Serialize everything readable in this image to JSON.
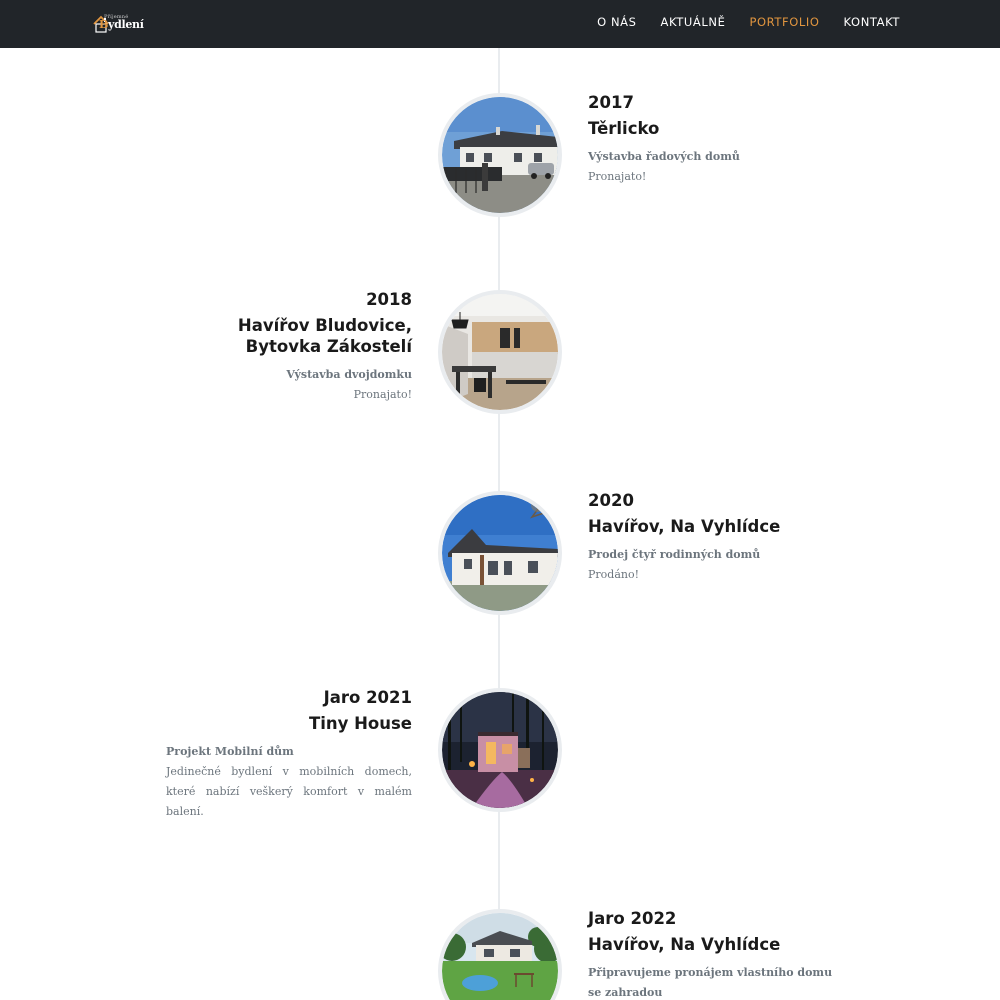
{
  "brand": {
    "small": "Příjemné",
    "name_first": "B",
    "name_rest": "ydlení"
  },
  "nav": [
    {
      "label": "O NÁS"
    },
    {
      "label": "AKTUÁLNĚ"
    },
    {
      "label": "PORTFOLIO",
      "active": true
    },
    {
      "label": "KONTAKT"
    }
  ],
  "colors": {
    "navbar": "#212529",
    "accent": "#e0953f",
    "timeline_line": "#e9ecef",
    "heading": "#1a1a1a",
    "muted": "#6c757d"
  },
  "timeline": [
    {
      "year": "2017",
      "title": "Těrlicko",
      "subtitle": "Výstavba řadových domů",
      "body": "Pronajato!",
      "image": "row-houses-photo"
    },
    {
      "year": "2018",
      "title_line1": "Havířov Bludovice,",
      "title_line2": "Bytovka Zákostelí",
      "subtitle": "Výstavba dvojdomku",
      "body": "Pronajato!",
      "image": "kitchen-interior-photo"
    },
    {
      "year": "2020",
      "title": "Havířov, Na Vyhlídce",
      "subtitle": "Prodej čtyř rodinných domů",
      "body": "Prodáno!",
      "image": "family-house-photo"
    },
    {
      "year": "Jaro 2021",
      "title": "Tiny House",
      "subtitle": "Projekt Mobilní dům",
      "body": "Jedinečné bydlení v mobilních domech, které nabízí veškerý komfort v malém balení.",
      "image": "tiny-house-photo"
    },
    {
      "year": "Jaro 2022",
      "title": "Havířov, Na Vyhlídce",
      "subtitle": "Připravujeme pronájem vlastního domu se zahradou",
      "image": "house-garden-render"
    }
  ]
}
